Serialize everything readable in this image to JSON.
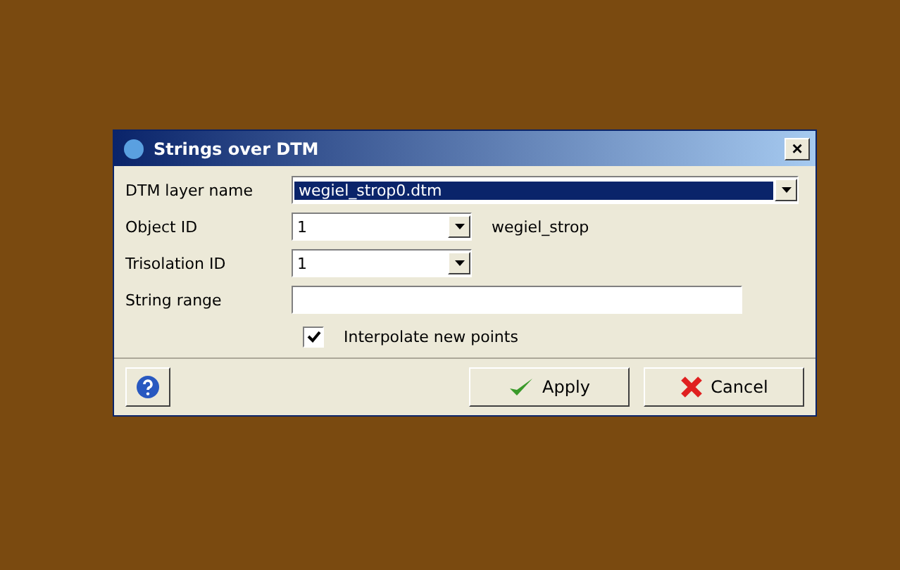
{
  "window": {
    "title": "Strings over DTM",
    "close": "×"
  },
  "fields": [
    {
      "kind": "combo",
      "label": "DTM layer name",
      "value": "wegiel_strop0.dtm",
      "wide": true,
      "highlighted": true
    },
    {
      "kind": "combo",
      "label": "Object ID",
      "value": "1",
      "wide": false,
      "highlighted": false,
      "note": "wegiel_strop"
    },
    {
      "kind": "combo",
      "label": "Trisolation ID",
      "value": "1",
      "wide": false,
      "highlighted": false
    },
    {
      "kind": "text",
      "label": "String range"
    }
  ],
  "checkbox": {
    "label": "Interpolate new points",
    "checked": true
  },
  "buttons": [
    {
      "kind": "apply",
      "label": "Apply"
    },
    {
      "kind": "cancel",
      "label": "Cancel"
    }
  ]
}
